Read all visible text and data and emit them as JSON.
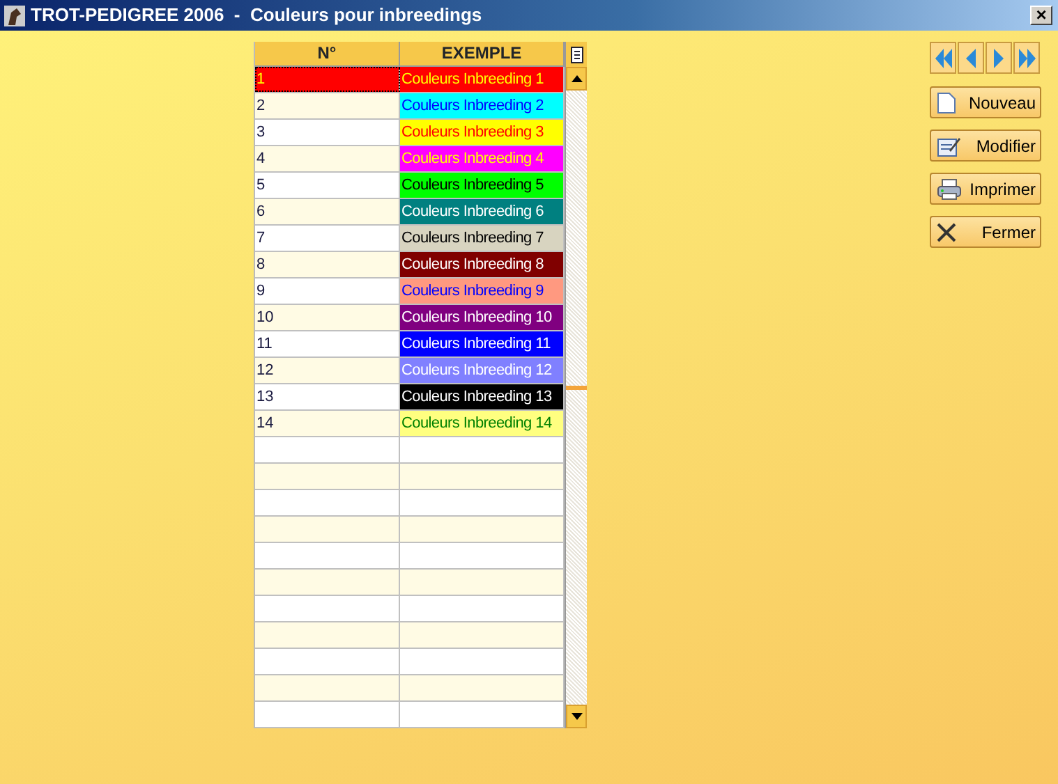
{
  "window": {
    "title": "TROT-PEDIGREE 2006  -  Couleurs pour inbreedings",
    "close": "×"
  },
  "table": {
    "columns": [
      "N°",
      "EXEMPLE"
    ],
    "rows": [
      {
        "number": "1",
        "color": "#ff0000",
        "example": {
          "text": "Couleurs Inbreeding 1",
          "color": "#ffff00"
        },
        "selected": true
      },
      {
        "number": "2",
        "color": "#00ffff",
        "example": {
          "text": "Couleurs Inbreeding 2",
          "color": "#0000ff"
        },
        "selected": false
      },
      {
        "number": "3",
        "color": "#ffff00",
        "example": {
          "text": "Couleurs Inbreeding 3",
          "color": "#ff0000"
        },
        "selected": false
      },
      {
        "number": "4",
        "color": "#ff00ff",
        "example": {
          "text": "Couleurs Inbreeding 4",
          "color": "#ffff00"
        },
        "selected": false
      },
      {
        "number": "5",
        "color": "#00ff00",
        "example": {
          "text": "Couleurs Inbreeding 5",
          "color": "#000000"
        },
        "selected": false
      },
      {
        "number": "6",
        "color": "#008080",
        "example": {
          "text": "Couleurs Inbreeding 6",
          "color": "#ffffff"
        },
        "selected": false
      },
      {
        "number": "7",
        "color": "#d8d4c0",
        "example": {
          "text": "Couleurs Inbreeding 7",
          "color": "#000000"
        },
        "selected": false
      },
      {
        "number": "8",
        "color": "#800000",
        "example": {
          "text": "Couleurs Inbreeding 8",
          "color": "#ffffff"
        },
        "selected": false
      },
      {
        "number": "9",
        "color": "#ff9980",
        "example": {
          "text": "Couleurs Inbreeding 9",
          "color": "#0000ff"
        },
        "selected": false
      },
      {
        "number": "10",
        "color": "#800080",
        "example": {
          "text": "Couleurs Inbreeding 10",
          "color": "#ffffff"
        },
        "selected": false
      },
      {
        "number": "11",
        "color": "#0000ff",
        "example": {
          "text": "Couleurs Inbreeding 11",
          "color": "#ffffff"
        },
        "selected": false
      },
      {
        "number": "12",
        "color": "#8080ff",
        "example": {
          "text": "Couleurs Inbreeding 12",
          "color": "#ffffff"
        },
        "selected": false
      },
      {
        "number": "13",
        "color": "#000000",
        "example": {
          "text": "Couleurs Inbreeding 13",
          "color": "#ffffff"
        },
        "selected": false
      },
      {
        "number": "14",
        "color": "#ffff80",
        "example": {
          "text": "Couleurs Inbreeding 14",
          "color": "#008000"
        },
        "selected": false
      }
    ]
  },
  "buttons": [
    {
      "kind": "new",
      "label": "Nouveau"
    },
    {
      "kind": "edit",
      "label": "Modifier"
    },
    {
      "kind": "print",
      "label": "Imprimer"
    },
    {
      "kind": "close",
      "label": "Fermer"
    }
  ]
}
